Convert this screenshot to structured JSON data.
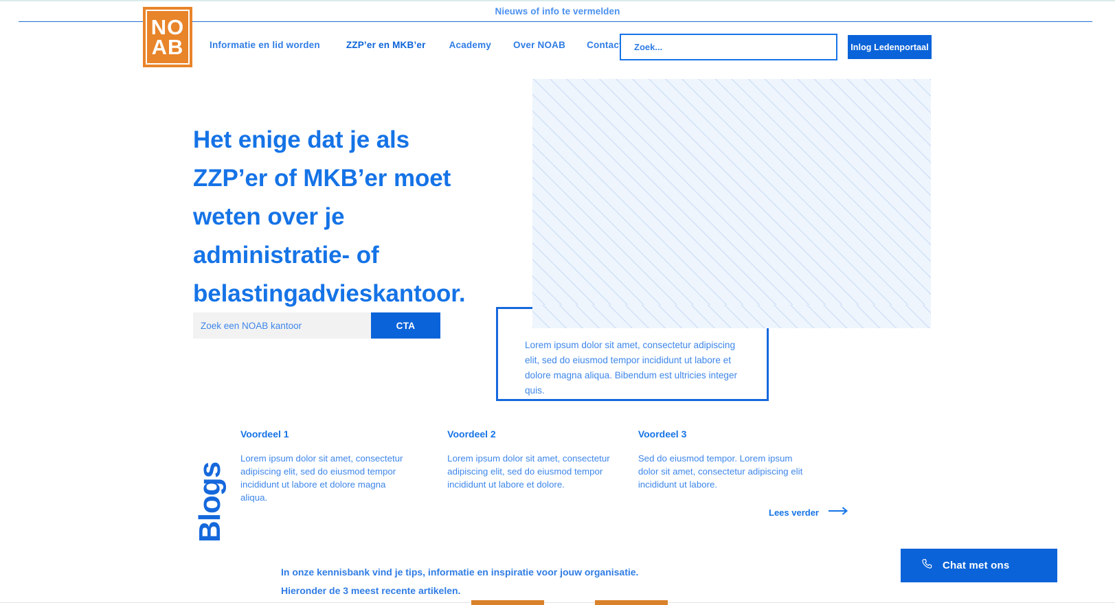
{
  "topbar": {
    "message": "Nieuws of info te vermelden"
  },
  "logo": {
    "line1": "NO",
    "line2": "AB",
    "alt": "NOAB"
  },
  "nav": {
    "items": [
      {
        "label": "Informatie en lid worden",
        "active": false
      },
      {
        "label": "ZZP’er en MKB’er",
        "active": true
      },
      {
        "label": "Academy",
        "active": false
      },
      {
        "label": "Over NOAB",
        "active": false
      },
      {
        "label": "Contact",
        "active": false
      }
    ]
  },
  "header": {
    "search_placeholder": "Zoek...",
    "search_value": "",
    "login_label": "Inlog Ledenportaal"
  },
  "hero": {
    "title": "Het enige dat je als ZZP’er of MKB’er moet weten over je administratie- of belastingadvieskantoor.",
    "search_placeholder": "Zoek een NOAB kantoor",
    "search_value": "",
    "cta_label": "CTA",
    "quote": "Lorem ipsum dolor sit amet, consectetur adipiscing elit, sed do eiusmod tempor incididunt ut labore et dolore magna aliqua. Bibendum est ultricies integer quis."
  },
  "benefits": [
    {
      "title": "Voordeel 1",
      "body": "Lorem ipsum dolor sit amet, consectetur adipiscing elit, sed do eiusmod tempor incididunt ut labore et dolore magna aliqua."
    },
    {
      "title": "Voordeel 2",
      "body": "Lorem ipsum dolor sit amet, consectetur adipiscing elit, sed do eiusmod tempor incididunt ut labore et dolore."
    },
    {
      "title": "Voordeel 3",
      "body": "Sed do eiusmod tempor. Lorem ipsum dolor sit amet, consectetur adipiscing elit incididunt ut labore."
    }
  ],
  "read_more": {
    "label": "Lees verder"
  },
  "blogs": {
    "heading": "Blogs",
    "intro": "In onze kennisbank vind je tips, informatie en inspiratie voor jouw organisatie. Hieronder de 3 meest recente artikelen."
  },
  "chat": {
    "label": "Chat met ons"
  },
  "colors": {
    "brand_blue": "#0a63d8",
    "link_blue": "#1573e6",
    "text_blue": "#3d86ea",
    "logo_orange": "#e8842a",
    "card_orange": "#d9822b",
    "placeholder_bg": "#eef5fd"
  }
}
